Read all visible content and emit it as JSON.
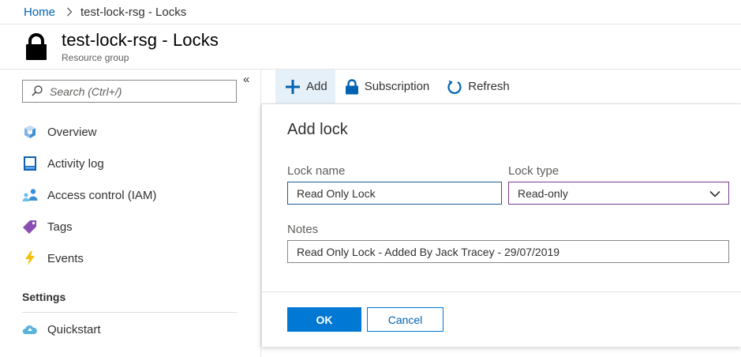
{
  "breadcrumb": {
    "home": "Home",
    "current": "test-lock-rsg - Locks"
  },
  "header": {
    "title": "test-lock-rsg - Locks",
    "subtitle": "Resource group"
  },
  "sidebar": {
    "search_placeholder": "Search (Ctrl+/)",
    "collapse": "«",
    "items": [
      {
        "label": "Overview",
        "icon": "cube-icon"
      },
      {
        "label": "Activity log",
        "icon": "log-icon"
      },
      {
        "label": "Access control (IAM)",
        "icon": "people-icon"
      },
      {
        "label": "Tags",
        "icon": "tag-icon"
      },
      {
        "label": "Events",
        "icon": "lightning-icon"
      }
    ],
    "settings_heading": "Settings",
    "settings_items": [
      {
        "label": "Quickstart",
        "icon": "cloud-icon"
      }
    ]
  },
  "toolbar": {
    "add": "Add",
    "subscription": "Subscription",
    "refresh": "Refresh"
  },
  "panel": {
    "title": "Add lock",
    "lock_name_label": "Lock name",
    "lock_name_value": "Read Only Lock",
    "lock_type_label": "Lock type",
    "lock_type_value": "Read-only",
    "notes_label": "Notes",
    "notes_value": "Read Only Lock - Added By Jack Tracey - 29/07/2019",
    "ok": "OK",
    "cancel": "Cancel"
  },
  "colors": {
    "accent": "#0078d4",
    "link": "#0063b1",
    "select_border": "#7a3b8f"
  }
}
